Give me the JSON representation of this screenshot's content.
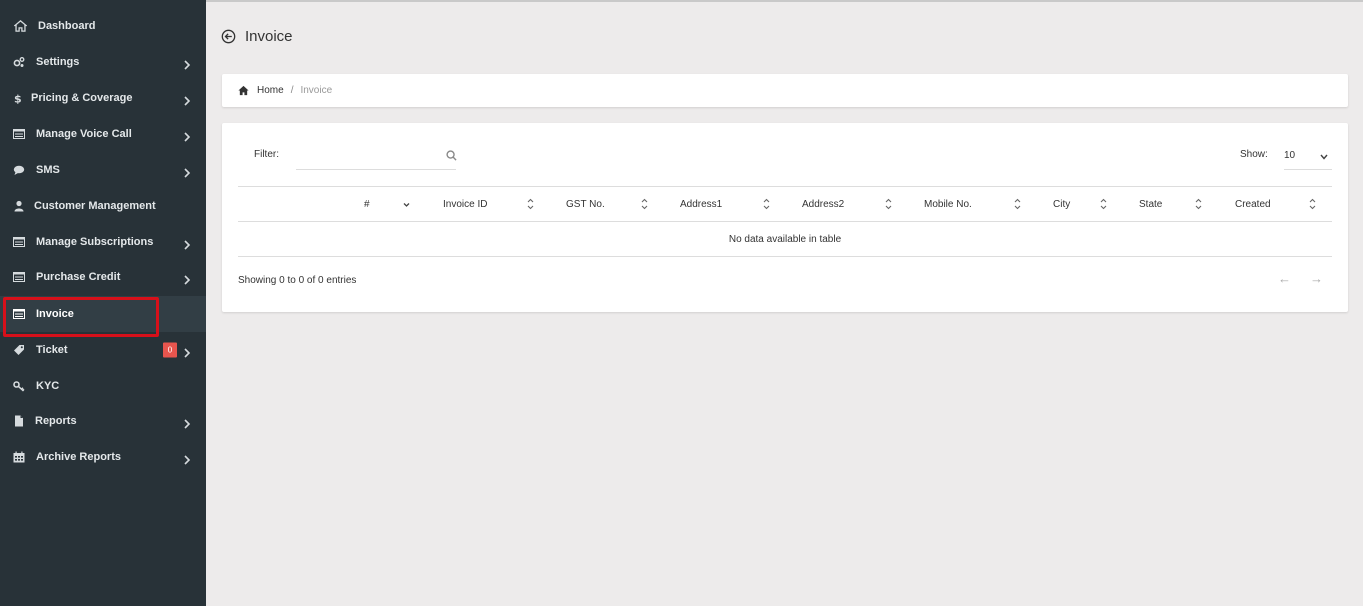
{
  "sidebar": {
    "items": [
      {
        "label": "Dashboard",
        "icon": "home-icon",
        "has_chevron": false
      },
      {
        "label": "Settings",
        "icon": "gears-icon",
        "has_chevron": true
      },
      {
        "label": "Pricing & Coverage",
        "icon": "dollar-icon",
        "has_chevron": true
      },
      {
        "label": "Manage Voice Call",
        "icon": "list-icon",
        "has_chevron": true
      },
      {
        "label": "SMS",
        "icon": "chat-icon",
        "has_chevron": true
      },
      {
        "label": "Customer Management",
        "icon": "user-icon",
        "has_chevron": false
      },
      {
        "label": "Manage Subscriptions",
        "icon": "list-icon",
        "has_chevron": true
      },
      {
        "label": "Purchase Credit",
        "icon": "list-icon",
        "has_chevron": true
      },
      {
        "label": "Invoice",
        "icon": "list-icon",
        "has_chevron": false,
        "active": true
      },
      {
        "label": "Ticket",
        "icon": "ticket-icon",
        "has_chevron": true,
        "badge": "0"
      },
      {
        "label": "KYC",
        "icon": "key-icon",
        "has_chevron": false
      },
      {
        "label": "Reports",
        "icon": "file-icon",
        "has_chevron": true
      },
      {
        "label": "Archive Reports",
        "icon": "calendar-icon",
        "has_chevron": true
      }
    ]
  },
  "header": {
    "title": "Invoice"
  },
  "breadcrumb": {
    "home": "Home",
    "separator": "/",
    "current": "Invoice"
  },
  "table": {
    "filter_label": "Filter:",
    "filter_value": "",
    "show_label": "Show:",
    "page_length": "10",
    "columns": [
      "#",
      "Invoice ID",
      "GST No.",
      "Address1",
      "Address2",
      "Mobile No.",
      "City",
      "State",
      "Created"
    ],
    "empty_text": "No data available in table",
    "info": "Showing 0 to 0 of 0 entries",
    "prev": "←",
    "next": "→"
  },
  "colors": {
    "sidebar_bg": "#283238",
    "active_item_bg": "#323e45",
    "highlight": "#d7101a",
    "badge": "#e8554e",
    "page_bg": "#edebeb"
  }
}
